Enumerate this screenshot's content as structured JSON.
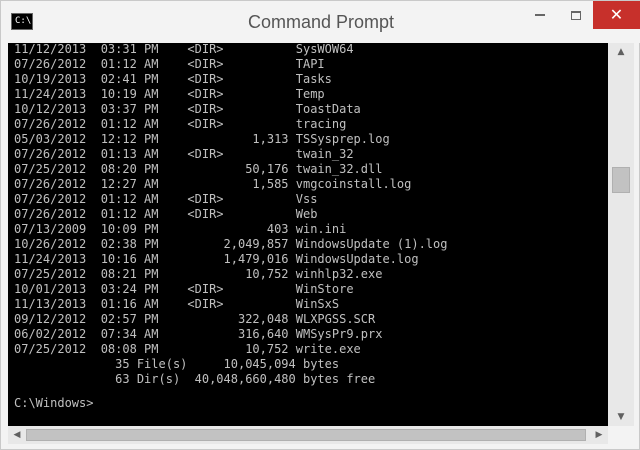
{
  "window": {
    "title": "Command Prompt",
    "icon_label": "C:\\",
    "icon": "console-icon",
    "min_icon": "minimize-icon",
    "max_icon": "maximize-icon",
    "close_icon": "close-icon",
    "close_glyph": "✕",
    "close_color": "#c7302b"
  },
  "console": {
    "background": "#000000",
    "foreground": "#c0c0c0",
    "lines": [
      "11/12/2013  03:31 PM    <DIR>          SysWOW64",
      "07/26/2012  01:12 AM    <DIR>          TAPI",
      "10/19/2013  02:41 PM    <DIR>          Tasks",
      "11/24/2013  10:19 AM    <DIR>          Temp",
      "10/12/2013  03:37 PM    <DIR>          ToastData",
      "07/26/2012  01:12 AM    <DIR>          tracing",
      "05/03/2012  12:12 PM             1,313 TSSysprep.log",
      "07/26/2012  01:13 AM    <DIR>          twain_32",
      "07/25/2012  08:20 PM            50,176 twain_32.dll",
      "07/26/2012  12:27 AM             1,585 vmgcoinstall.log",
      "07/26/2012  01:12 AM    <DIR>          Vss",
      "07/26/2012  01:12 AM    <DIR>          Web",
      "07/13/2009  10:09 PM               403 win.ini",
      "10/26/2012  02:38 PM         2,049,857 WindowsUpdate (1).log",
      "11/24/2013  10:16 AM         1,479,016 WindowsUpdate.log",
      "07/25/2012  08:21 PM            10,752 winhlp32.exe",
      "10/01/2013  03:24 PM    <DIR>          WinStore",
      "11/13/2013  01:16 AM    <DIR>          WinSxS",
      "09/12/2012  02:57 PM           322,048 WLXPGSS.SCR",
      "06/02/2012  07:34 AM           316,640 WMSysPr9.prx",
      "07/25/2012  08:08 PM            10,752 write.exe",
      "              35 File(s)     10,045,094 bytes",
      "              63 Dir(s)  40,048,660,480 bytes free"
    ],
    "prompt": "C:\\Windows>"
  },
  "scrollbars": {
    "up_arrow": "▲",
    "down_arrow": "▼",
    "left_arrow": "◀",
    "right_arrow": "▶"
  }
}
